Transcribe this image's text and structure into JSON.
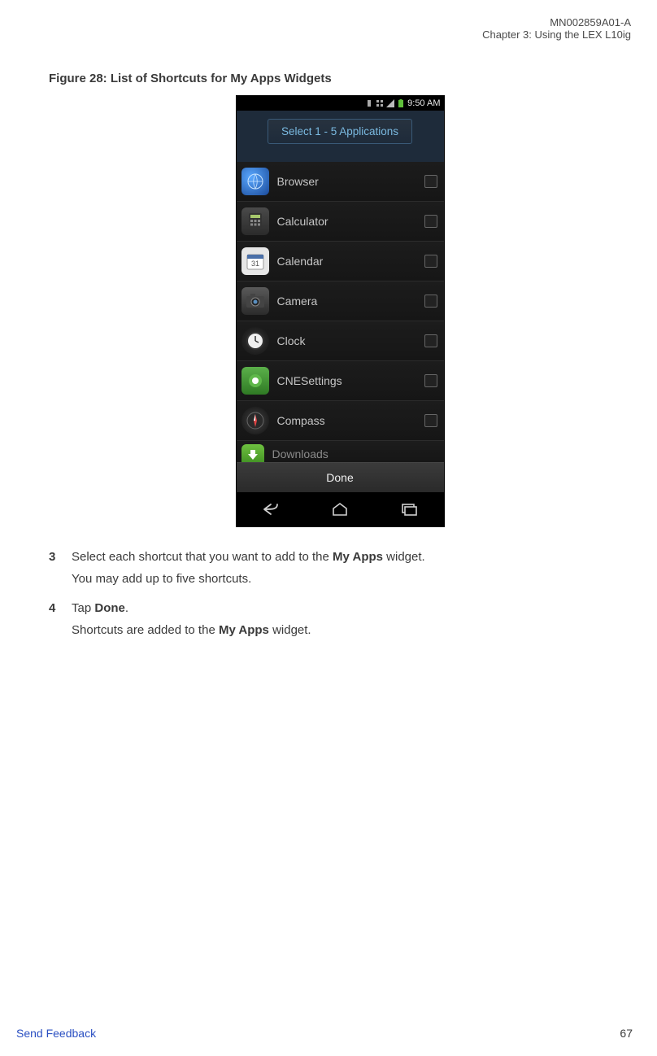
{
  "header": {
    "doc_id": "MN002859A01-A",
    "chapter": "Chapter 3:  Using the LEX L10ig"
  },
  "figure": {
    "caption": "Figure 28: List of Shortcuts for My Apps Widgets"
  },
  "phone": {
    "statusbar": {
      "time": "9:50 AM"
    },
    "banner": "Select 1 - 5 Applications",
    "apps": [
      {
        "label": "Browser"
      },
      {
        "label": "Calculator"
      },
      {
        "label": "Calendar"
      },
      {
        "label": "Camera"
      },
      {
        "label": "Clock"
      },
      {
        "label": "CNESettings"
      },
      {
        "label": "Compass"
      },
      {
        "label": "Downloads"
      }
    ],
    "done": "Done"
  },
  "steps": {
    "s3": {
      "num": "3",
      "line_pre": "Select each shortcut that you want to add to the ",
      "line_bold": "My Apps",
      "line_post": " widget.",
      "follow": "You may add up to five shortcuts."
    },
    "s4": {
      "num": "4",
      "line_pre": "Tap ",
      "line_bold": "Done",
      "line_post": ".",
      "follow_pre": "Shortcuts are added to the ",
      "follow_bold": "My Apps",
      "follow_post": " widget."
    }
  },
  "footer": {
    "link": "Send Feedback",
    "page": "67"
  }
}
